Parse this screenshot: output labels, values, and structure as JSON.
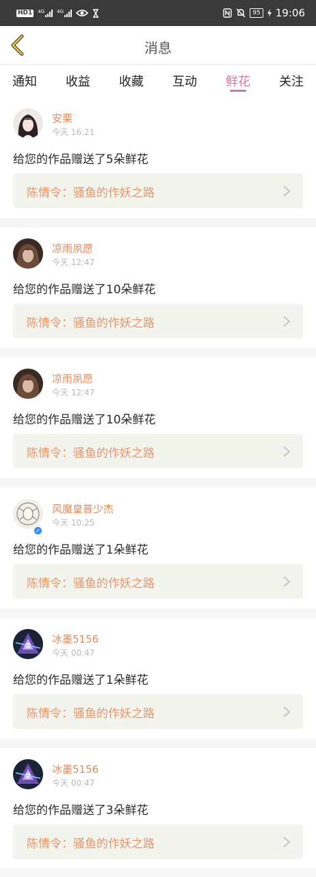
{
  "status_bar": {
    "hd": "HD",
    "sim": "1",
    "net1": "4G",
    "net2": "4G",
    "battery": "95",
    "time": "19:06"
  },
  "header": {
    "title": "消息",
    "back_icon": "chevron-left-icon"
  },
  "tabs": [
    {
      "label": "通知",
      "active": false
    },
    {
      "label": "收益",
      "active": false
    },
    {
      "label": "收藏",
      "active": false
    },
    {
      "label": "互动",
      "active": false
    },
    {
      "label": "鲜花",
      "active": true
    },
    {
      "label": "关注",
      "active": false
    }
  ],
  "colors": {
    "accent": "#d977a3",
    "username": "#e08a5c",
    "work_title": "#e6956a",
    "link_bg": "#f4f4ee"
  },
  "messages": [
    {
      "user": "安栗",
      "time": "今天 16:21",
      "text": "给您的作品赠送了5朵鲜花",
      "work": "陈情令：骚鱼的作妖之路",
      "avatar": "avatar-girl",
      "verified": false
    },
    {
      "user": "凉雨夙愿",
      "time": "今天 12:47",
      "text": "给您的作品赠送了10朵鲜花",
      "work": "陈情令：骚鱼的作妖之路",
      "avatar": "avatar-dark",
      "verified": false
    },
    {
      "user": "凉雨夙愿",
      "time": "今天 12:47",
      "text": "给您的作品赠送了10朵鲜花",
      "work": "陈情令：骚鱼的作妖之路",
      "avatar": "avatar-dark",
      "verified": false
    },
    {
      "user": "风魔皇普少杰",
      "time": "今天 10:25",
      "text": "给您的作品赠送了1朵鲜花",
      "work": "陈情令：骚鱼的作妖之路",
      "avatar": "avatar-sketch",
      "verified": true
    },
    {
      "user": "冰墨5156",
      "time": "今天 00:47",
      "text": "给您的作品赠送了1朵鲜花",
      "work": "陈情令：骚鱼的作妖之路",
      "avatar": "avatar-purple",
      "verified": false
    },
    {
      "user": "冰墨5156",
      "time": "今天 00:47",
      "text": "给您的作品赠送了3朵鲜花",
      "work": "陈情令：骚鱼的作妖之路",
      "avatar": "avatar-purple",
      "verified": false
    }
  ]
}
